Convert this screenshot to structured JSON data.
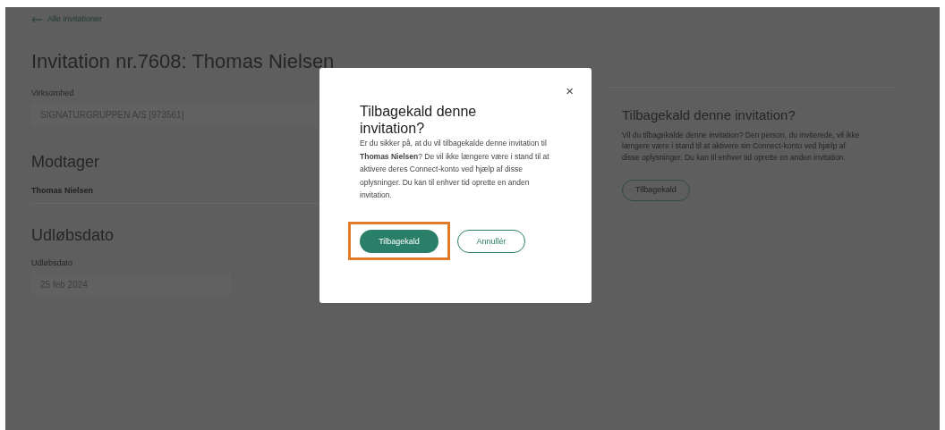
{
  "back_link": "Alle invitationer",
  "title": "Invitation nr.7608: Thomas Nielsen",
  "company": {
    "label": "Virksomhed",
    "value": "SIGNATURGRUPPEN A/S [973561]"
  },
  "recipient": {
    "heading": "Modtager",
    "value": "Thomas Nielsen"
  },
  "expiry": {
    "heading": "Udløbsdato",
    "label": "Udløbsdato",
    "value": "25 feb 2024"
  },
  "revoke_panel": {
    "heading": "Tilbagekald denne invitation?",
    "text": "Vil du tilbagekalde denne invitation? Den person, du inviterede, vil ikke længere være i stand til at aktivere sin Connect-konto ved hjælp af disse oplysninger. Du kan til enhver tid oprette en anden invitation.",
    "button": "Tilbagekald"
  },
  "dialog": {
    "close": "×",
    "title": "Tilbagekald denne invitation?",
    "text": "Er du sikker på, at du vil tilbagekalde denne invitation til **Thomas Nielsen**? De vil ikke længere være i stand til at aktivere deres Connect-konto ved hjælp af disse oplysninger. Du kan til enhver tid oprette en anden invitation.",
    "buttons": [
      {
        "label": "Tilbagekald",
        "kind": "primary",
        "highlighted": true
      },
      {
        "label": "Annullér",
        "kind": "secondary",
        "highlighted": false
      }
    ]
  }
}
